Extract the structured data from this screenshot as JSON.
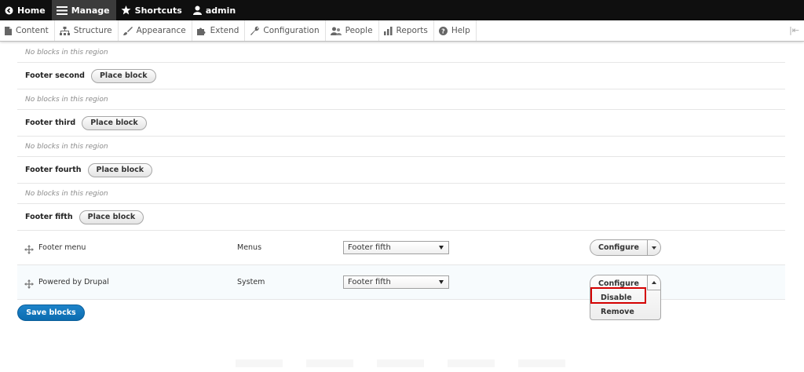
{
  "toolbar": {
    "items": [
      {
        "label": "Home",
        "icon": "home-circle-icon"
      },
      {
        "label": "Manage",
        "icon": "hamburger-icon"
      },
      {
        "label": "Shortcuts",
        "icon": "star-icon"
      },
      {
        "label": "admin",
        "icon": "user-icon"
      }
    ]
  },
  "tray": {
    "items": [
      {
        "label": "Content",
        "icon": "document-icon"
      },
      {
        "label": "Structure",
        "icon": "sitemap-icon"
      },
      {
        "label": "Appearance",
        "icon": "paintbrush-icon"
      },
      {
        "label": "Extend",
        "icon": "puzzle-icon"
      },
      {
        "label": "Configuration",
        "icon": "wrench-icon"
      },
      {
        "label": "People",
        "icon": "people-icon"
      },
      {
        "label": "Reports",
        "icon": "bar-chart-icon"
      },
      {
        "label": "Help",
        "icon": "question-icon"
      }
    ],
    "toggle_glyph": "|⇤"
  },
  "table": {
    "empty_text": "No blocks in this region",
    "place_block_label": "Place block",
    "regions": [
      {
        "title": "Footer second"
      },
      {
        "title": "Footer third"
      },
      {
        "title": "Footer fourth"
      },
      {
        "title": "Footer fifth"
      }
    ],
    "blocks": [
      {
        "name": "Footer menu",
        "category": "Menus",
        "region": "Footer fifth",
        "operation": "Configure"
      },
      {
        "name": "Powered by Drupal",
        "category": "System",
        "region": "Footer fifth",
        "operation": "Configure",
        "dropdown_options": [
          "Disable",
          "Remove"
        ]
      }
    ]
  },
  "save_label": "Save blocks",
  "colors": {
    "accent": "#0b6cb0",
    "highlight": "#d40000",
    "toolbar": "#0f0f0f"
  }
}
